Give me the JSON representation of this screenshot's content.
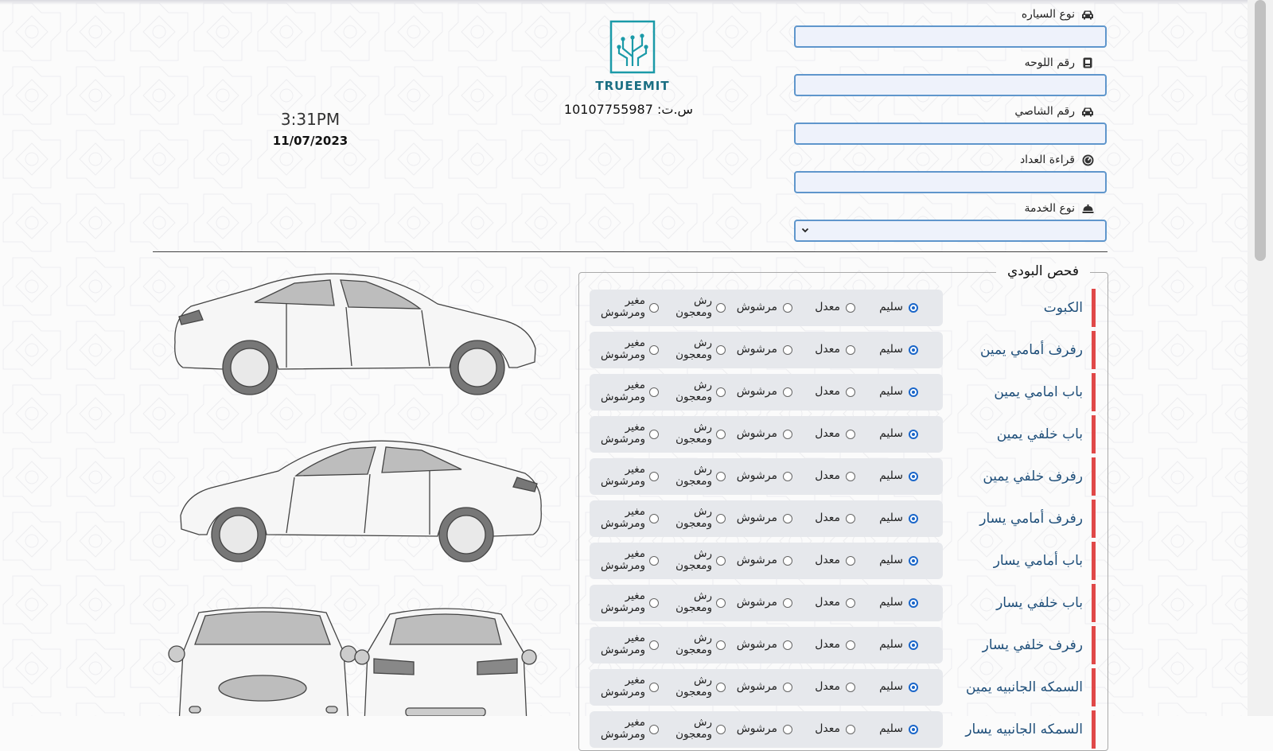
{
  "header": {
    "fields": [
      {
        "label": "نوع السياره",
        "icon": "car-icon",
        "value": ""
      },
      {
        "label": "رقم اللوحه",
        "icon": "plate-icon",
        "value": ""
      },
      {
        "label": "رقم الشاصي",
        "icon": "car-icon",
        "value": ""
      },
      {
        "label": "قراءة العداد",
        "icon": "gauge-icon",
        "value": ""
      }
    ],
    "service": {
      "label": "نوع الخدمة",
      "icon": "service-bell-icon",
      "selected": ""
    },
    "logo_text": "TRUEEMIT",
    "commercial_register": "س.ت: 10107755987",
    "time": "3:31PM",
    "date": "11/07/2023"
  },
  "inspection": {
    "legend": "فحص البودي",
    "options": [
      "سليم",
      "معدل",
      "مرشوش",
      "رش ومعجون",
      "مغير ومرشوش"
    ],
    "option_lines": {
      "paint_filler": [
        "رش",
        "ومعجون"
      ],
      "replaced_painted": [
        "مغير",
        "ومرشوش"
      ]
    },
    "parts": [
      {
        "name": "الكبوت",
        "selected": "سليم"
      },
      {
        "name": "رفرف أمامي يمين",
        "selected": "سليم"
      },
      {
        "name": "باب امامي يمين",
        "selected": "سليم"
      },
      {
        "name": "باب خلفي يمين",
        "selected": "سليم"
      },
      {
        "name": "رفرف خلفي يمين",
        "selected": "سليم"
      },
      {
        "name": "رفرف أمامي يسار",
        "selected": "سليم"
      },
      {
        "name": "باب أمامي يسار",
        "selected": "سليم"
      },
      {
        "name": "باب خلفي يسار",
        "selected": "سليم"
      },
      {
        "name": "رفرف خلفي يسار",
        "selected": "سليم"
      },
      {
        "name": "السمكه الجانبيه يمين",
        "selected": "سليم"
      },
      {
        "name": "السمكه الجانبيه يسار",
        "selected": "سليم"
      }
    ]
  },
  "colors": {
    "input_border": "#5f96cc",
    "input_bg": "#eef2fb",
    "accent_red": "#e04848",
    "part_text": "#1f4f7a",
    "radio_on": "#1a66c9",
    "logo": "#1b9aa8"
  }
}
